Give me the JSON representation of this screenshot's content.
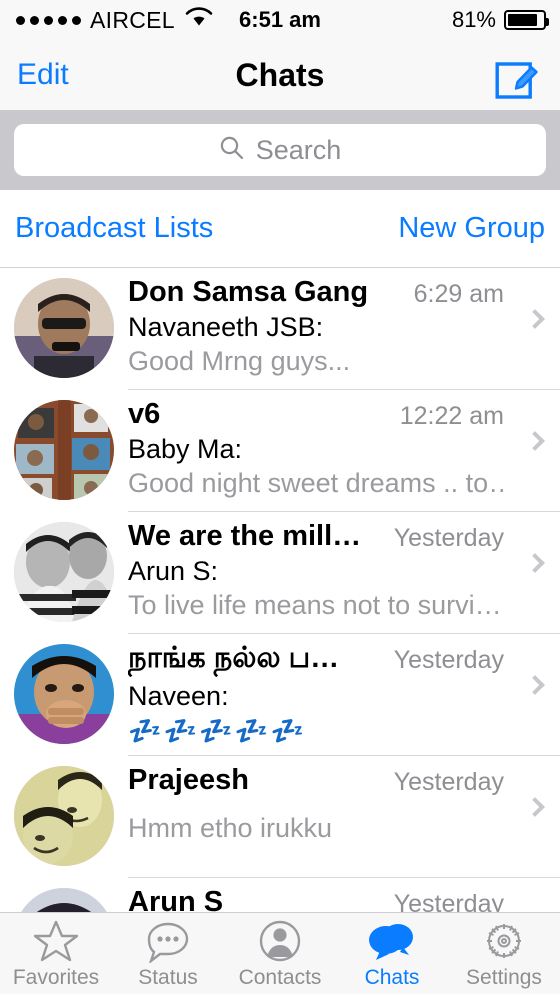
{
  "status_bar": {
    "signal_dots": 5,
    "carrier": "AIRCEL",
    "wifi_icon": "wifi-icon",
    "time": "6:51 am",
    "battery_percent": "81%",
    "battery_level": 81
  },
  "nav": {
    "edit_label": "Edit",
    "title": "Chats",
    "compose_icon": "compose-pencil-icon"
  },
  "search": {
    "placeholder": "Search",
    "value": "",
    "icon": "search-icon"
  },
  "actions": {
    "broadcast_label": "Broadcast Lists",
    "new_group_label": "New Group"
  },
  "colors": {
    "accent_blue": "#0a7cff",
    "secondary_text": "#8e8e93",
    "preview_text": "#9b9b9f",
    "separator": "#d8d8da",
    "search_bg": "#c9c8cd",
    "nav_bg": "#f8f8f8",
    "tabbar_bg": "#f7f7f7",
    "emoji_blue": "#2457a5"
  },
  "chats": [
    {
      "title": "Don Samsa Gang",
      "time": "6:29 am",
      "sender": "Navaneeth JSB:",
      "preview": "Good Mrng guys...",
      "is_group": true,
      "avatar": "photo-man-sunglasses"
    },
    {
      "title": "v6",
      "time": "12:22 am",
      "sender": "Baby Ma:",
      "preview": "Good night sweet dreams .. to…",
      "is_group": true,
      "avatar": "photo-collage"
    },
    {
      "title": "We are the mill…",
      "time": "Yesterday",
      "sender": "Arun S:",
      "preview": "To live life  means not to survi…",
      "is_group": true,
      "avatar": "photo-two-men-bw"
    },
    {
      "title": "நாங்க நல்ல ப…",
      "time": "Yesterday",
      "sender": "Naveen:",
      "preview": "💤💤💤💤💤",
      "is_group": true,
      "is_emoji_preview": true,
      "avatar": "photo-man-hand-mouth"
    },
    {
      "title": "Prajeesh",
      "time": "Yesterday",
      "sender": "",
      "preview": "Hmm etho irukku",
      "is_group": false,
      "avatar": "photo-two-people-sepia"
    },
    {
      "title": "Arun S",
      "time": "Yesterday",
      "sender": "",
      "preview": "",
      "is_group": false,
      "avatar": "photo-dark-hair"
    }
  ],
  "tabs": [
    {
      "label": "Favorites",
      "icon": "star-icon",
      "active": false
    },
    {
      "label": "Status",
      "icon": "speech-bubble-icon",
      "active": false
    },
    {
      "label": "Contacts",
      "icon": "person-circle-icon",
      "active": false
    },
    {
      "label": "Chats",
      "icon": "chat-bubbles-icon",
      "active": true
    },
    {
      "label": "Settings",
      "icon": "gear-icon",
      "active": false
    }
  ]
}
